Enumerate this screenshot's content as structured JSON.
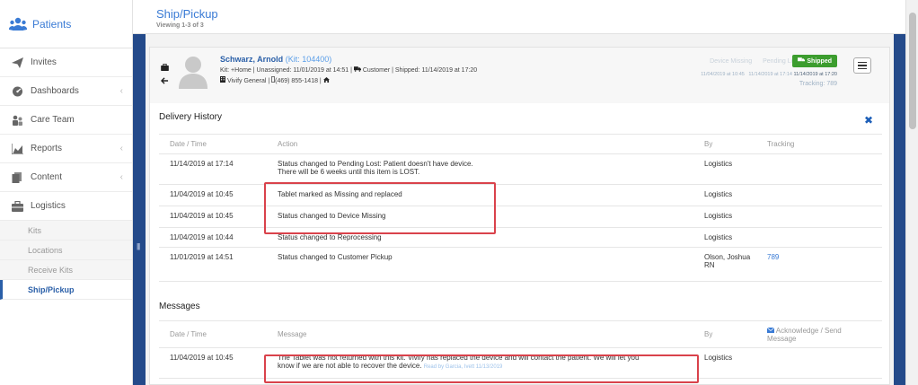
{
  "brand": {
    "name": "Patients"
  },
  "nav": {
    "items": [
      {
        "label": "Invites",
        "chevron": false
      },
      {
        "label": "Dashboards",
        "chevron": true
      },
      {
        "label": "Care Team",
        "chevron": false
      },
      {
        "label": "Reports",
        "chevron": true
      },
      {
        "label": "Content",
        "chevron": true
      },
      {
        "label": "Logistics",
        "chevron": false
      }
    ],
    "chevron_glyph": "‹",
    "sub_items": [
      "Kits",
      "Locations",
      "Receive Kits",
      "Ship/Pickup"
    ],
    "active_sub": "Ship/Pickup"
  },
  "header": {
    "title": "Ship/Pickup",
    "viewing": "Viewing 1-3 of 3"
  },
  "strip": {
    "grip": "|||"
  },
  "kit": {
    "last_name": "Schwarz",
    "first_name": ", Arnold",
    "kit_id": "(Kit: 104400)",
    "line1_a": "Kit: +Home | Unassigned: 11/01/2019 at 14:51 | ",
    "line1_b": "Customer | Shipped: 11/14/2019 at 17:20",
    "line2_a": "Vivify General | ",
    "line2_b": "(469) 855-1418 | "
  },
  "status": {
    "device_missing": "Device Missing",
    "pending_lost": "Pending Lost",
    "shipped_label": "Shipped",
    "date1": "11/04/2019 at 10:45",
    "date2": "11/14/2019 at 17:14",
    "date3": "11/14/2019 at 17:20",
    "tracking": "Tracking: 789"
  },
  "delivery": {
    "title": "Delivery History",
    "close": "✖",
    "columns": [
      "Date / Time",
      "Action",
      "By",
      "Tracking"
    ],
    "rows": [
      {
        "date": "11/14/2019 at 17:14",
        "action": "Status changed to Pending Lost: Patient doesn't have device.",
        "action2": "There will be 6 weeks until this item is LOST.",
        "by": "Logistics",
        "by2": "",
        "tracking": ""
      },
      {
        "date": "11/04/2019 at 10:45",
        "action": "Tablet marked as Missing and replaced",
        "action2": "",
        "by": "Logistics",
        "by2": "",
        "tracking": ""
      },
      {
        "date": "11/04/2019 at 10:45",
        "action": "Status changed to Device Missing",
        "action2": "",
        "by": "Logistics",
        "by2": "",
        "tracking": ""
      },
      {
        "date": "11/04/2019 at 10:44",
        "action": "Status changed to Reprocessing",
        "action2": "",
        "by": "Logistics",
        "by2": "",
        "tracking": ""
      },
      {
        "date": "11/01/2019 at 14:51",
        "action": "Status changed to Customer Pickup",
        "action2": "",
        "by": "Olson, Joshua",
        "by2": "RN",
        "tracking": "789"
      }
    ]
  },
  "messages": {
    "title": "Messages",
    "columns": [
      "Date / Time",
      "Message",
      "By"
    ],
    "ack_line1": "Acknowledge / Send",
    "ack_line2": "Message",
    "rows": [
      {
        "date": "11/04/2019 at 10:45",
        "message": "The Tablet was not returned with this kit. Vivify has replaced the device and will contact the patient. We will let you",
        "message2": "know if we are not able to recover the device. ",
        "read_by": "Read by Garcia, Ivett 11/13/2019",
        "by": "Logistics"
      }
    ]
  },
  "colors": {
    "accent": "#3a7bd5",
    "strip": "#244a8a",
    "shipped": "#3c9d2e",
    "highlight": "#d9424b"
  }
}
